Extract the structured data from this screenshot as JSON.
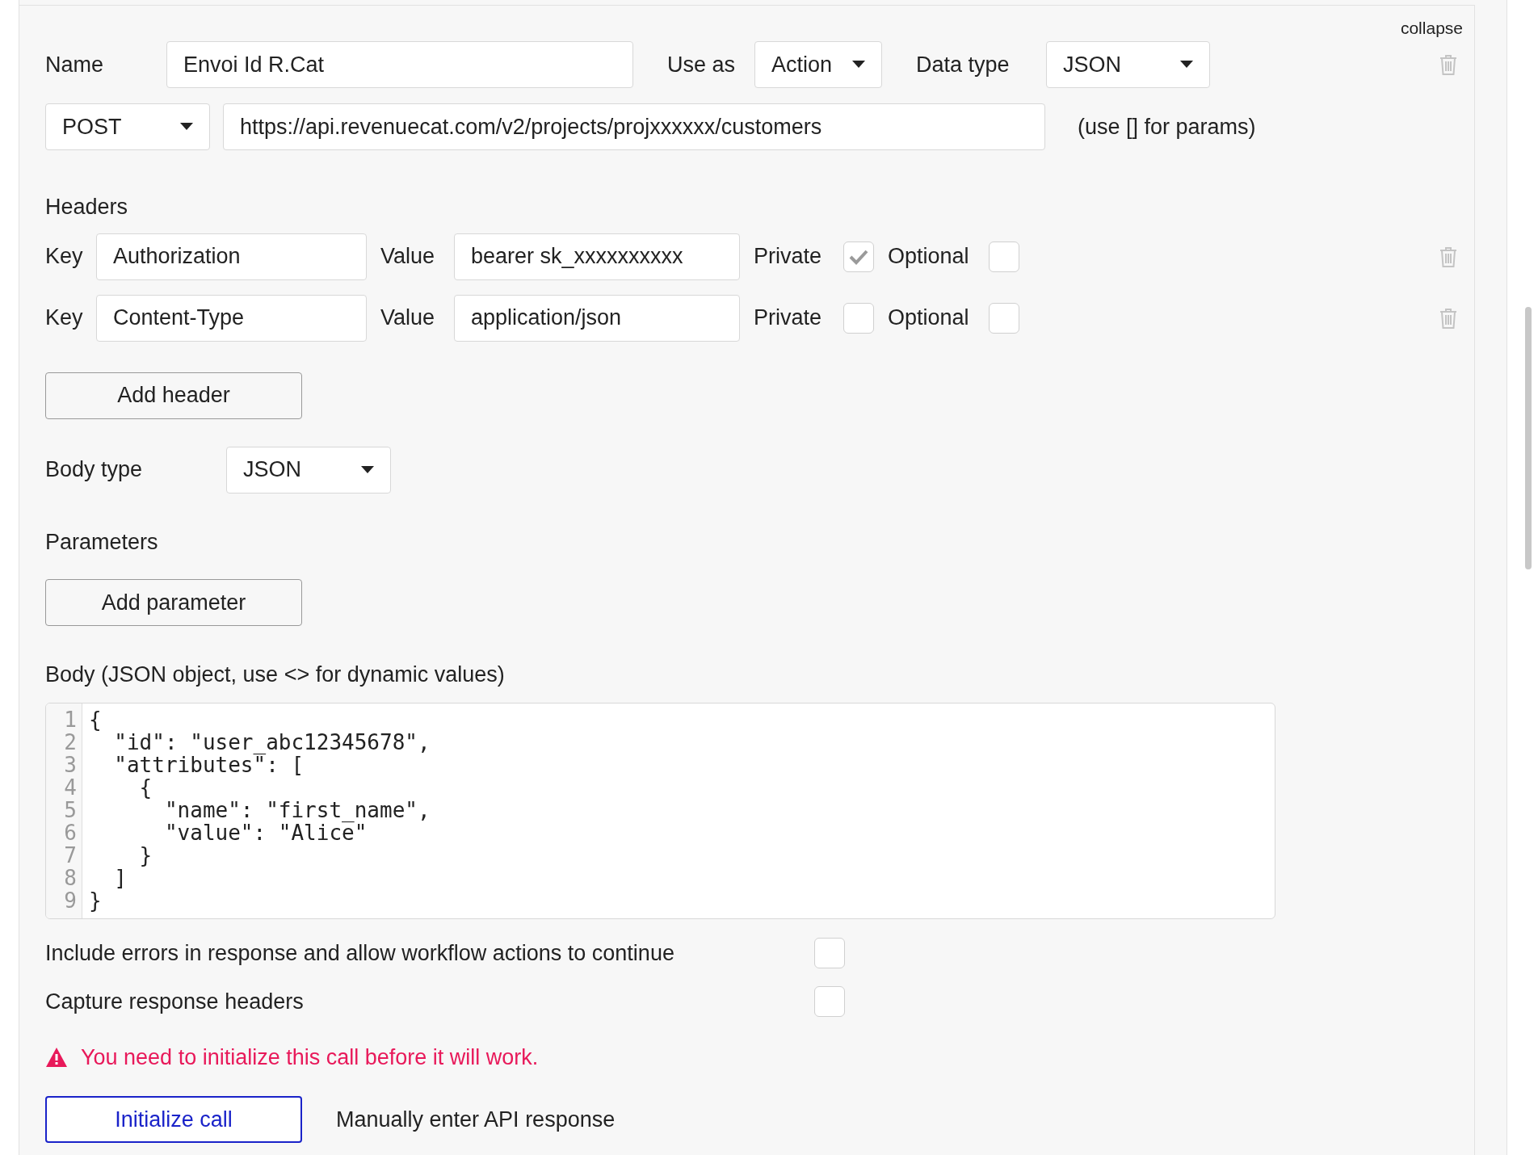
{
  "collapse_link": "collapse",
  "call": {
    "name_label": "Name",
    "name_value": "Envoi Id R.Cat",
    "use_as_label": "Use as",
    "use_as_value": "Action",
    "data_type_label": "Data type",
    "data_type_value": "JSON"
  },
  "request": {
    "method": "POST",
    "url": "https://api.revenuecat.com/v2/projects/projxxxxxx/customers",
    "hint": "(use [] for params)"
  },
  "headers_label": "Headers",
  "headers": [
    {
      "key_label": "Key",
      "key": "Authorization",
      "value_label": "Value",
      "value": "bearer sk_xxxxxxxxxx",
      "private_label": "Private",
      "private": true,
      "optional_label": "Optional",
      "optional": false
    },
    {
      "key_label": "Key",
      "key": "Content-Type",
      "value_label": "Value",
      "value": "application/json",
      "private_label": "Private",
      "private": false,
      "optional_label": "Optional",
      "optional": false
    }
  ],
  "add_header_button": "Add header",
  "body_type": {
    "label": "Body type",
    "value": "JSON"
  },
  "parameters_label": "Parameters",
  "add_parameter_button": "Add parameter",
  "body_label": "Body (JSON object, use <> for dynamic values)",
  "body_lines": [
    {
      "number": "1",
      "text": "{"
    },
    {
      "number": "2",
      "text": "  \"id\": \"user_abc12345678\","
    },
    {
      "number": "3",
      "text": "  \"attributes\": ["
    },
    {
      "number": "4",
      "text": "    {"
    },
    {
      "number": "5",
      "text": "      \"name\": \"first_name\","
    },
    {
      "number": "6",
      "text": "      \"value\": \"Alice\""
    },
    {
      "number": "7",
      "text": "    }"
    },
    {
      "number": "8",
      "text": "  ]"
    },
    {
      "number": "9",
      "text": "}"
    }
  ],
  "options": [
    {
      "label": "Include errors in response and allow workflow actions to continue",
      "checked": false
    },
    {
      "label": "Capture response headers",
      "checked": false
    }
  ],
  "warning": "You need to initialize this call before it will work.",
  "initialize_button": "Initialize call",
  "manual_link": "Manually enter API response"
}
